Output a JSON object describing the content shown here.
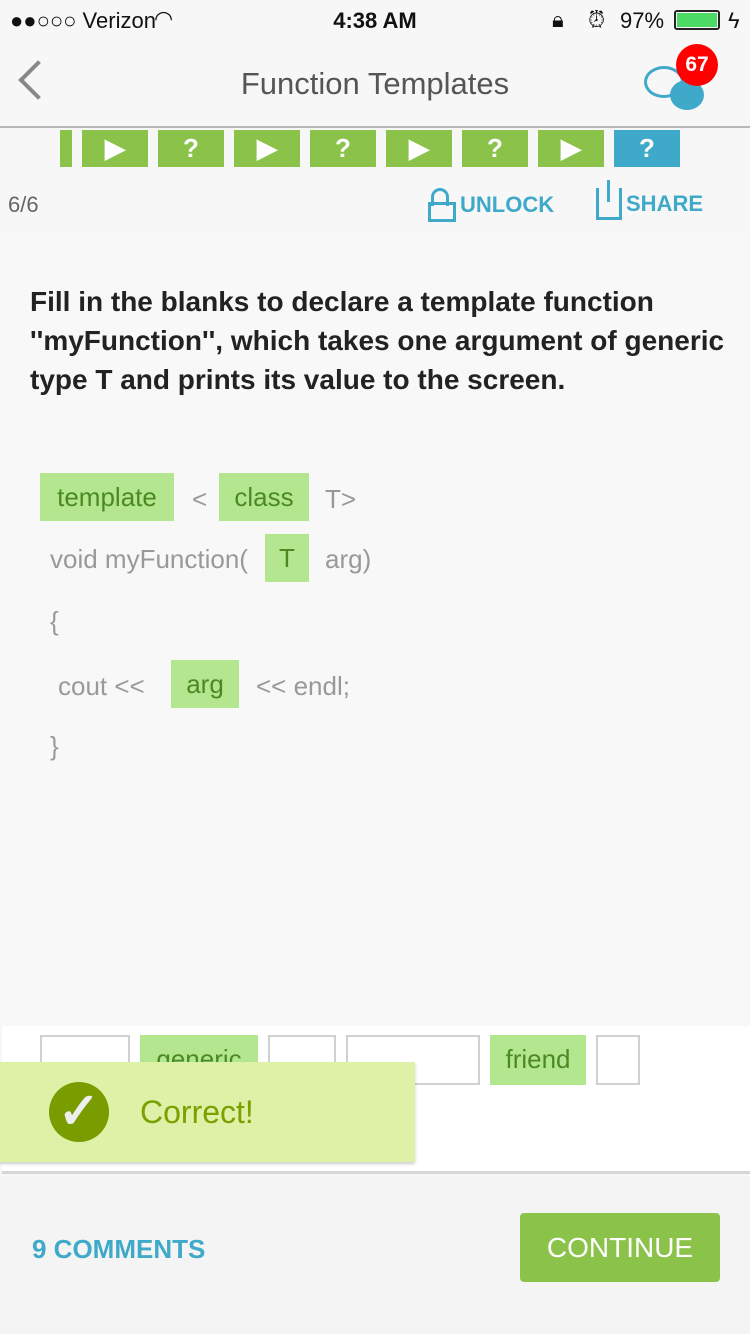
{
  "status": {
    "carrier": "●●○○○ Verizon",
    "time": "4:38 AM",
    "battery": "97%"
  },
  "nav": {
    "title": "Function Templates",
    "badge": "67"
  },
  "steps": [
    {
      "type": "play"
    },
    {
      "type": "quiz",
      "label": "?"
    },
    {
      "type": "play"
    },
    {
      "type": "quiz",
      "label": "?"
    },
    {
      "type": "play"
    },
    {
      "type": "quiz",
      "label": "?"
    },
    {
      "type": "play"
    },
    {
      "type": "quiz",
      "label": "?",
      "active": true
    }
  ],
  "progress": "6/6",
  "actions": {
    "unlock": "UNLOCK",
    "share": "SHARE"
  },
  "question": "Fill in the blanks to declare a template function ''myFunction'', which takes one argument of generic type T and prints its value to the screen.",
  "code": {
    "l1_chip1": "template",
    "l1_lt": "<",
    "l1_chip2": "class",
    "l1_end": "T>",
    "l2_start": "void myFunction(",
    "l2_chip": "T",
    "l2_end": "arg)",
    "l3": "{",
    "l4_start": "cout <<",
    "l4_chip": "arg",
    "l4_end": "<< endl;",
    "l5": "}"
  },
  "bank": [
    "",
    "generic",
    "",
    "",
    "friend",
    ""
  ],
  "toast": "Correct!",
  "footer": {
    "comments": "9 COMMENTS",
    "continue": "CONTINUE"
  },
  "colors": {
    "green": "#8bc34a",
    "blue": "#3fa9c9"
  }
}
